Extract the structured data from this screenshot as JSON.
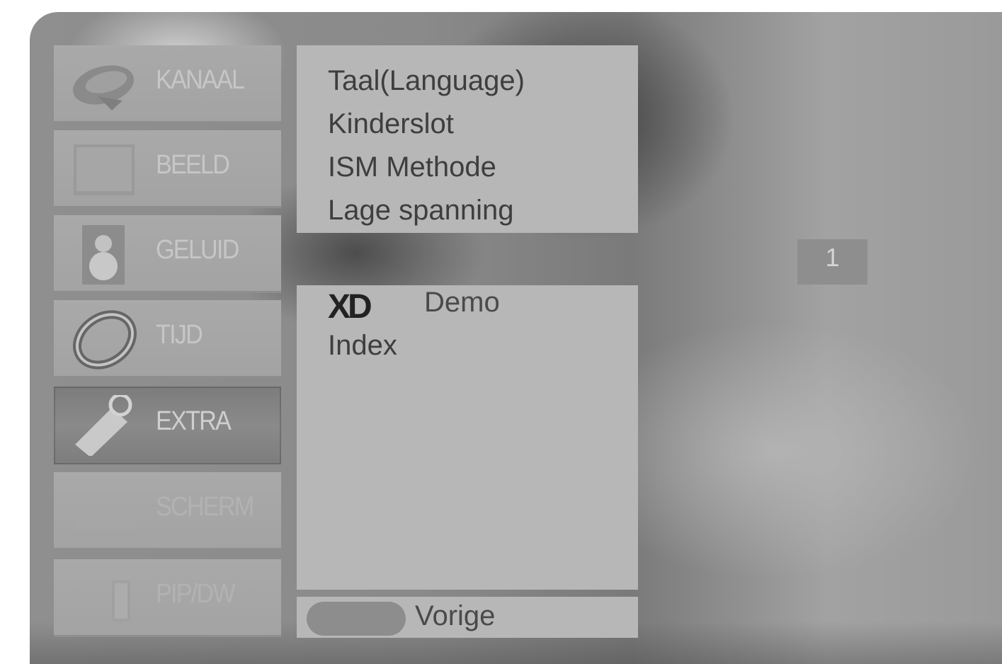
{
  "categories": [
    {
      "label": "KANAAL",
      "icon": "satellite-dish-icon",
      "state": "normal"
    },
    {
      "label": "BEELD",
      "icon": "picture-screen-icon",
      "state": "normal"
    },
    {
      "label": "GELUID",
      "icon": "speaker-icon",
      "state": "normal"
    },
    {
      "label": "TIJD",
      "icon": "clock-ring-icon",
      "state": "normal"
    },
    {
      "label": "EXTRA",
      "icon": "tag-icon",
      "state": "selected"
    },
    {
      "label": "SCHERM",
      "icon": "screen-icon",
      "state": "dim"
    },
    {
      "label": "PIP/DW",
      "icon": "pip-icon",
      "state": "dim"
    }
  ],
  "submenu": {
    "items": [
      "Taal(Language)",
      "Kinderslot",
      "ISM Methode",
      "Lage spanning"
    ]
  },
  "lower_panel": {
    "xd_logo_text": "XD",
    "demo_label": "Demo",
    "index_label": "Index"
  },
  "footer": {
    "back_label": "Vorige"
  },
  "page_indicator": "1",
  "colors": {
    "panel": "#b7b7b7",
    "text": "#3e3e3e",
    "selected_category": "#7c7c7c"
  }
}
